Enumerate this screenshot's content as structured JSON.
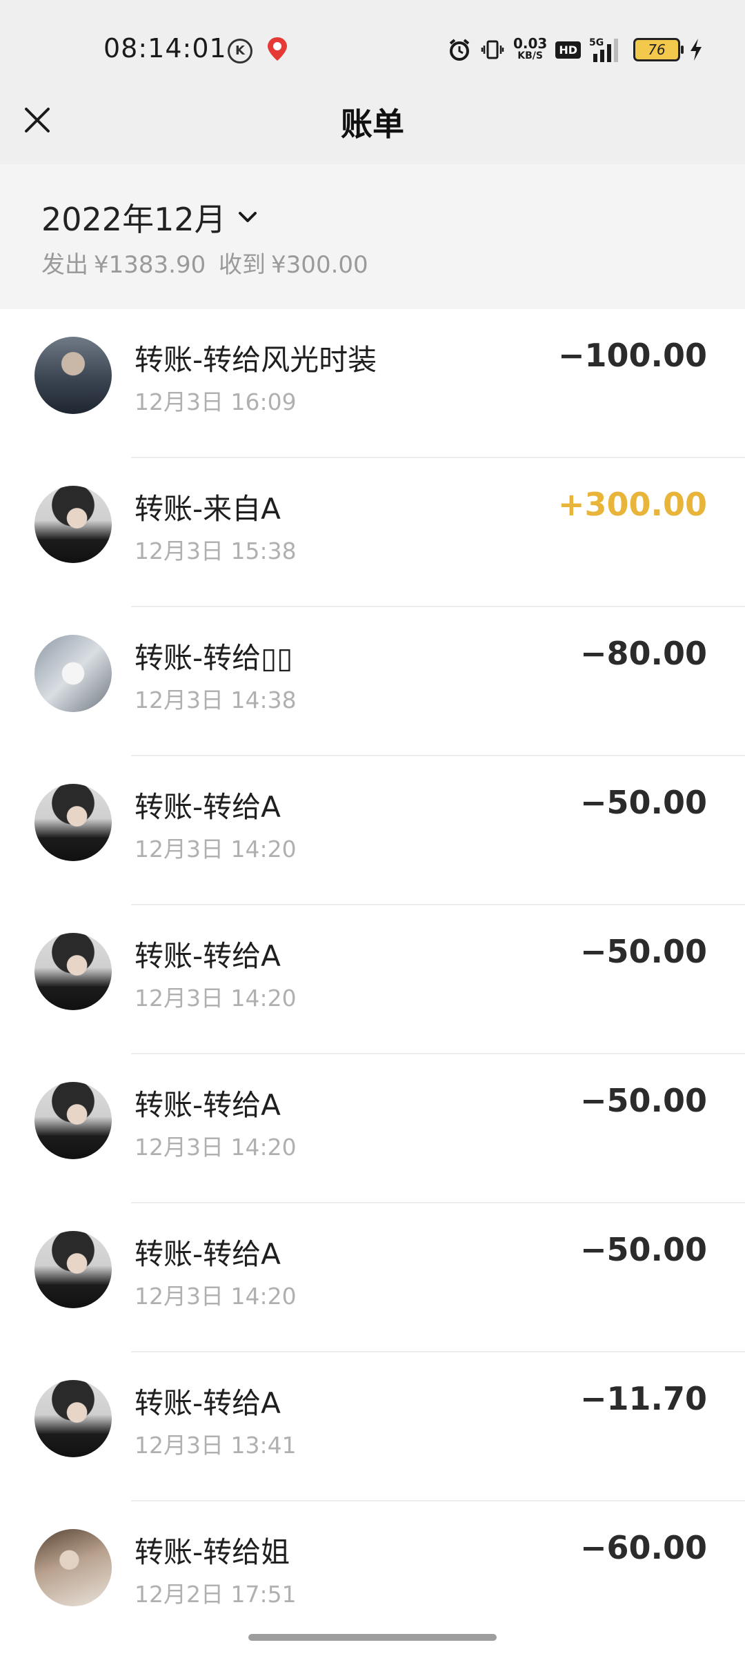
{
  "status_bar": {
    "time": "08:14:01",
    "k_badge": "K",
    "net_speed_value": "0.03",
    "net_speed_unit": "KB/S",
    "hd": "HD",
    "network": "5G",
    "battery": "76"
  },
  "header": {
    "title": "账单"
  },
  "month": {
    "selected": "2022年12月",
    "summary_out_label": "发出",
    "summary_out_value": "¥1383.90",
    "summary_in_label": "收到",
    "summary_in_value": "¥300.00"
  },
  "transactions": [
    {
      "title": "转账-转给风光时装",
      "time": "12月3日 16:09",
      "amount": "−100.00",
      "avatar": "suit-man"
    },
    {
      "title": "转账-来自A",
      "time": "12月3日 15:38",
      "amount": "+300.00",
      "avatar": "boy",
      "income": true
    },
    {
      "title": "转账-转给▯▯",
      "time": "12月3日 14:38",
      "amount": "−80.00",
      "avatar": "car"
    },
    {
      "title": "转账-转给A",
      "time": "12月3日 14:20",
      "amount": "−50.00",
      "avatar": "boy"
    },
    {
      "title": "转账-转给A",
      "time": "12月3日 14:20",
      "amount": "−50.00",
      "avatar": "boy"
    },
    {
      "title": "转账-转给A",
      "time": "12月3日 14:20",
      "amount": "−50.00",
      "avatar": "boy"
    },
    {
      "title": "转账-转给A",
      "time": "12月3日 14:20",
      "amount": "−50.00",
      "avatar": "boy"
    },
    {
      "title": "转账-转给A",
      "time": "12月3日 13:41",
      "amount": "−11.70",
      "avatar": "boy"
    },
    {
      "title": "转账-转给姐",
      "time": "12月2日 17:51",
      "amount": "−60.00",
      "avatar": "girl"
    }
  ],
  "colors": {
    "income": "#e8b53a",
    "expense": "#2b2b2b",
    "secondary_text": "#b0b0b0",
    "header_bg": "#efefef"
  }
}
